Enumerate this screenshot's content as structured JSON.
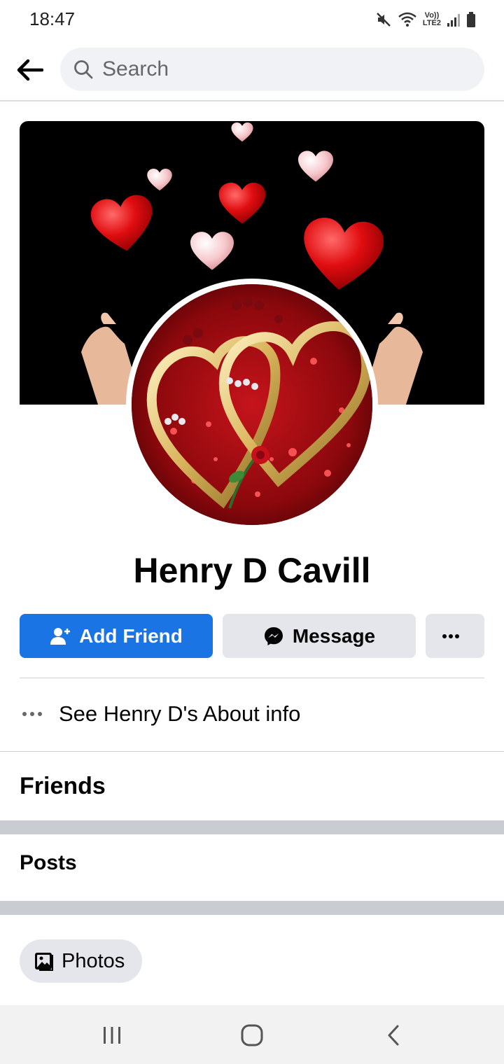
{
  "status_bar": {
    "time": "18:47",
    "icons": [
      "mute-icon",
      "wifi-icon",
      "volte-lte2-icon",
      "signal-icon",
      "battery-icon"
    ],
    "volte_label": "Vo))",
    "lte_label": "LTE2"
  },
  "search": {
    "placeholder": "Search"
  },
  "profile": {
    "name": "Henry D Cavill"
  },
  "actions": {
    "add_friend_label": "Add Friend",
    "message_label": "Message"
  },
  "about": {
    "label": "See Henry D's About info"
  },
  "sections": {
    "friends_title": "Friends",
    "posts_title": "Posts"
  },
  "chips": {
    "photos_label": "Photos"
  },
  "colors": {
    "accent": "#1b74e4",
    "button_gray": "#e4e6eb",
    "search_bg": "#f0f2f5",
    "separator": "#c9ccd1"
  }
}
